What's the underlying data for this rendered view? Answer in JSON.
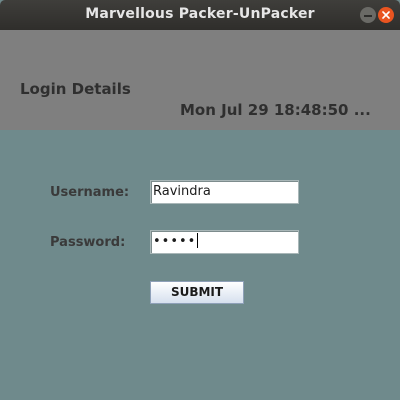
{
  "window": {
    "title": "Marvellous Packer-UnPacker"
  },
  "header": {
    "heading": "Login Details",
    "datetime": "Mon Jul 29 18:48:50 ..."
  },
  "form": {
    "username_label": "Username:",
    "username_value": "Ravindra",
    "password_label": "Password:",
    "password_masked": "•••••",
    "submit_label": "SUBMIT"
  },
  "icons": {
    "minimize": "minimize-icon",
    "close": "close-icon"
  },
  "colors": {
    "title_bar": "#2f2e2b",
    "close_button": "#e95420",
    "header_panel": "#7f7f7f",
    "body_panel": "#6f8a8c"
  }
}
